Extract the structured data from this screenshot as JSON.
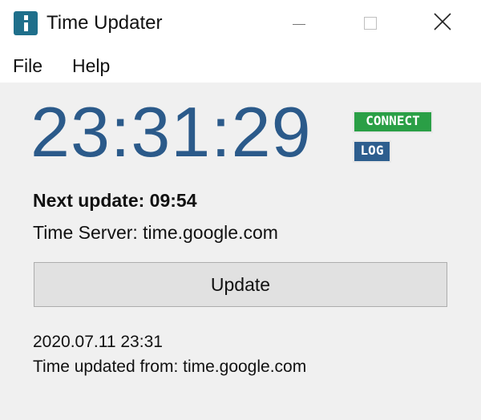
{
  "window": {
    "title": "Time Updater",
    "icon": "app-icon",
    "controls": [
      "minimize-icon",
      "maximize-icon",
      "close-icon"
    ]
  },
  "menu": {
    "file": "File",
    "help": "Help"
  },
  "clock": {
    "time": "23:31:29",
    "color": "#2b5a8a"
  },
  "badges": {
    "connect": "CONNECT",
    "connect_color": "#2a9f46",
    "log": "LOG",
    "log_color": "#2d5e8e"
  },
  "info": {
    "next_update": "Next update: 09:54",
    "server": "Time Server: time.google.com"
  },
  "update_button": {
    "label": "Update"
  },
  "status": {
    "date": "2020.07.11 23:31",
    "updated_from": "Time updated from: time.google.com"
  }
}
